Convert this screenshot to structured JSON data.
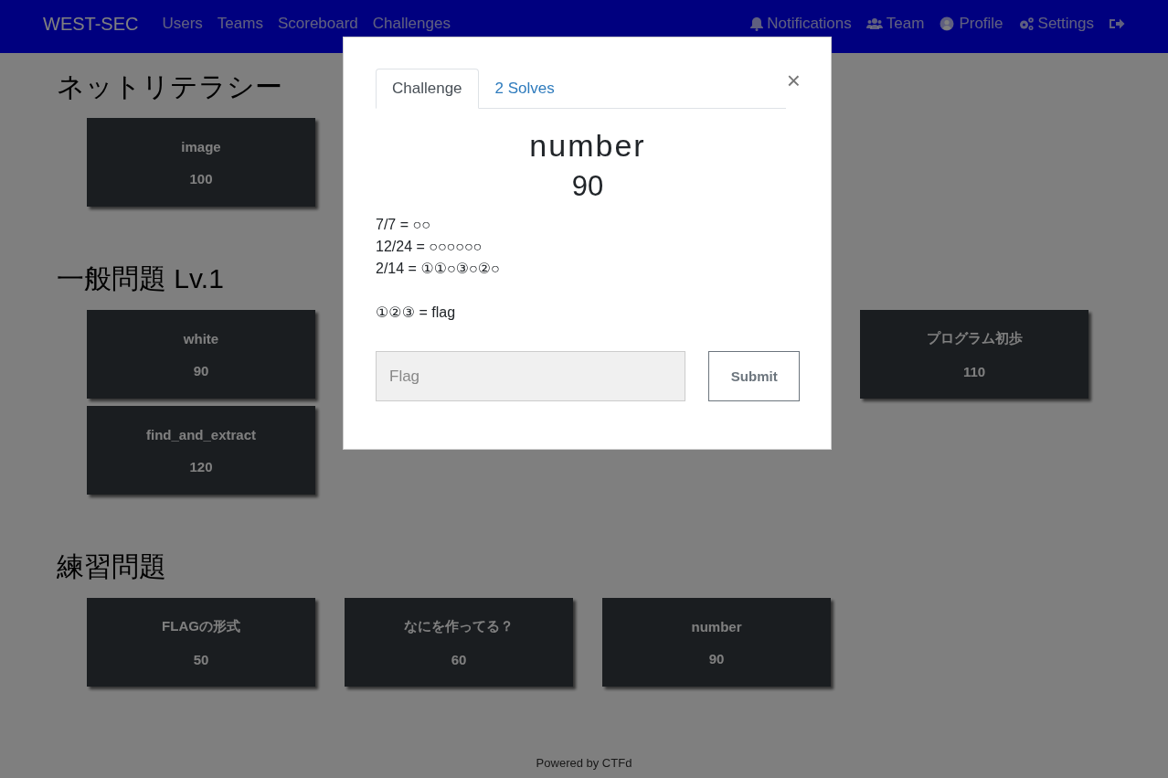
{
  "navbar": {
    "brand": "WEST-SEC",
    "links": [
      {
        "label": "Users"
      },
      {
        "label": "Teams"
      },
      {
        "label": "Scoreboard"
      },
      {
        "label": "Challenges"
      }
    ],
    "right_links": [
      {
        "kind": "bell",
        "label": "Notifications"
      },
      {
        "kind": "users",
        "label": "Team"
      },
      {
        "kind": "user",
        "label": "Profile"
      },
      {
        "kind": "gears",
        "label": "Settings"
      },
      {
        "kind": "logout"
      }
    ]
  },
  "categories": [
    {
      "title": "ネットリテラシー",
      "cards": [
        {
          "kind": "challenge",
          "name": "image",
          "value": "100"
        },
        {
          "kind": "covered"
        },
        {
          "kind": "covered"
        }
      ]
    },
    {
      "title": "一般問題 Lv.1",
      "cards": [
        {
          "kind": "challenge",
          "name": "white",
          "value": "90"
        },
        {
          "kind": "covered"
        },
        {
          "kind": "covered"
        },
        {
          "kind": "challenge",
          "name": "プログラム初歩",
          "value": "110"
        },
        {
          "kind": "challenge",
          "name": "find_and_extract",
          "value": "120"
        }
      ]
    },
    {
      "title": "練習問題",
      "cards": [
        {
          "kind": "challenge",
          "name": "FLAGの形式",
          "value": "50"
        },
        {
          "kind": "challenge",
          "name": "なにを作ってる？",
          "value": "60"
        },
        {
          "kind": "challenge",
          "name": "number",
          "value": "90"
        }
      ]
    }
  ],
  "footer": {
    "text": "Powered by CTFd"
  },
  "modal": {
    "tabs": [
      {
        "label": "Challenge",
        "selected": true
      },
      {
        "label": "2 Solves",
        "selected": false
      }
    ],
    "close": "×",
    "title": "number",
    "value": "90",
    "description": [
      [
        "7/7 = ○○",
        "12/24 = ○○○○○○",
        "2/14 = ①①○③○②○"
      ],
      [
        "①②③ = flag"
      ]
    ],
    "flag_field": {
      "placeholder": "Flag"
    },
    "submit": "Submit"
  }
}
